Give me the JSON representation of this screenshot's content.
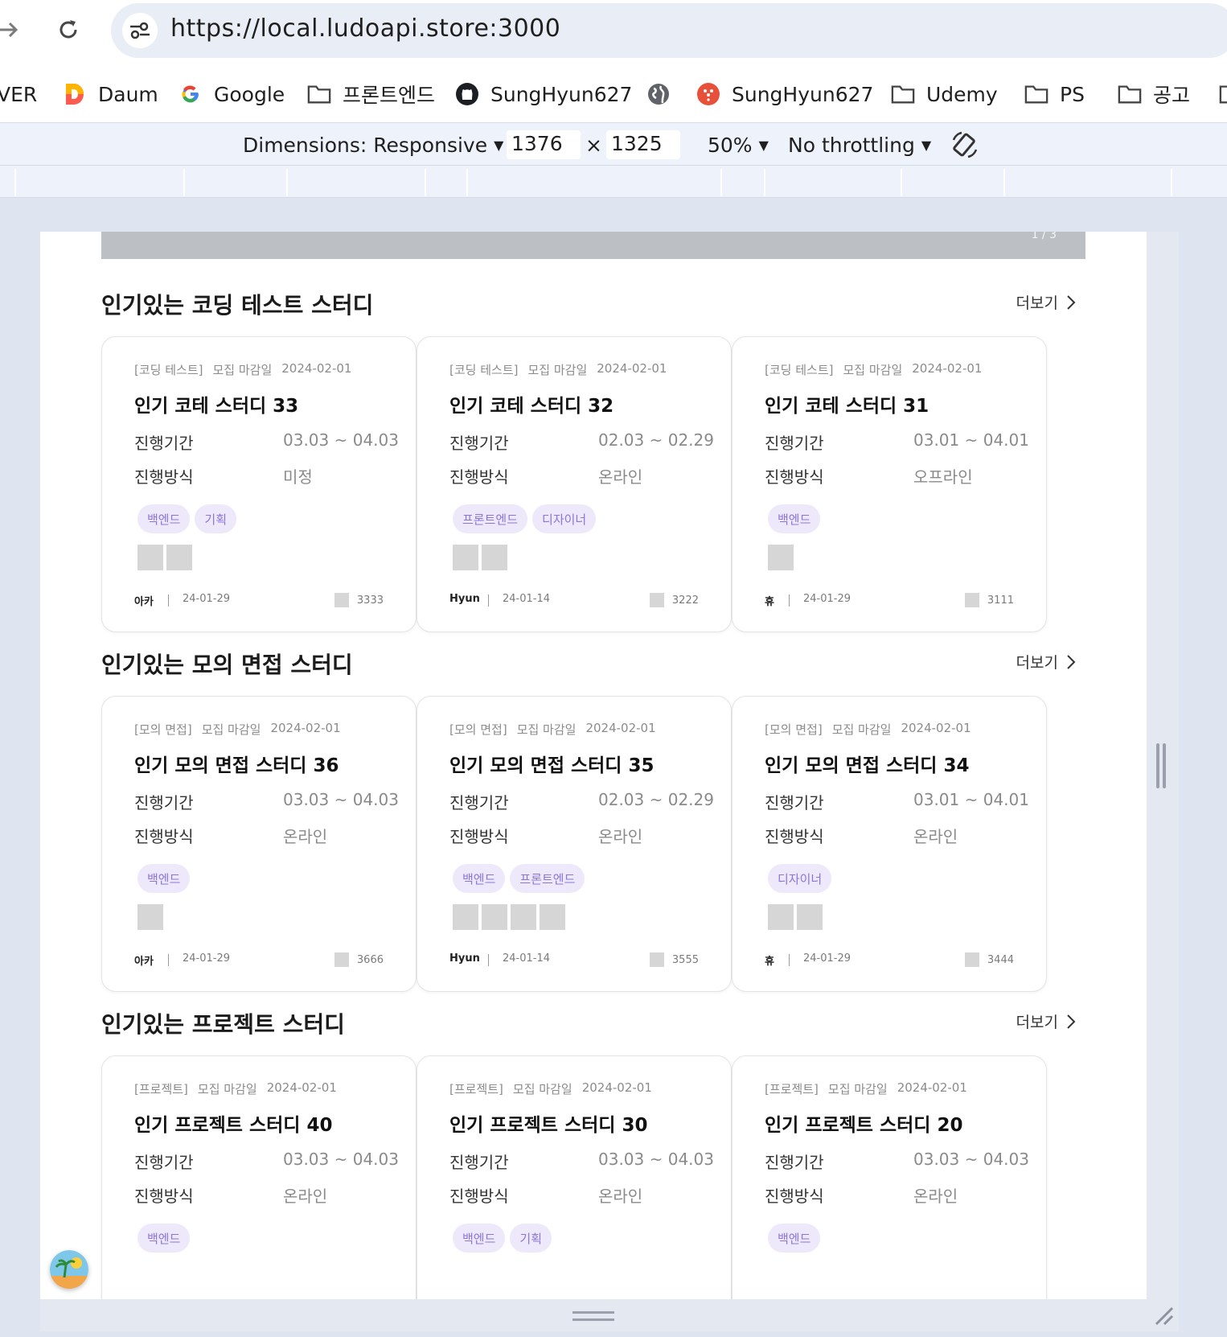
{
  "browser": {
    "url": "https://local.ludoapi.store:3000",
    "bookmarks": [
      {
        "label": "VER",
        "icon": "naver-icon"
      },
      {
        "label": "Daum",
        "icon": "daum-icon"
      },
      {
        "label": "Google",
        "icon": "google-icon"
      },
      {
        "label": "프론트엔드",
        "icon": "folder-icon"
      },
      {
        "label": "SungHyun627",
        "icon": "github-icon"
      },
      {
        "label": "",
        "icon": "globe-icon"
      },
      {
        "label": "SungHyun627",
        "icon": "app-icon"
      },
      {
        "label": "Udemy",
        "icon": "folder-icon"
      },
      {
        "label": "PS",
        "icon": "folder-icon"
      },
      {
        "label": "공고",
        "icon": "folder-icon"
      }
    ]
  },
  "devtools": {
    "dimensions_label": "Dimensions: Responsive",
    "width": "1376",
    "times": "×",
    "height": "1325",
    "zoom": "50%",
    "throttling": "No throttling"
  },
  "banner": {
    "page_indicator": "1 / 3"
  },
  "sections": [
    {
      "title": "인기있는 코딩 테스트 스터디",
      "more_label": "더보기",
      "cards": [
        {
          "category": "[코딩 테스트]",
          "deadline_label": "모집 마감일",
          "deadline": "2024-02-01",
          "title": "인기 코테 스터디 33",
          "period_label": "진행기간",
          "period": "03.03 ~ 04.03",
          "method_label": "진행방식",
          "method": "미정",
          "tags": [
            "백엔드",
            "기획"
          ],
          "stack_count": 2,
          "author": "아카",
          "created": "24-01-29",
          "views": "3333"
        },
        {
          "category": "[코딩 테스트]",
          "deadline_label": "모집 마감일",
          "deadline": "2024-02-01",
          "title": "인기 코테 스터디 32",
          "period_label": "진행기간",
          "period": "02.03 ~ 02.29",
          "method_label": "진행방식",
          "method": "온라인",
          "tags": [
            "프론트엔드",
            "디자이너"
          ],
          "stack_count": 2,
          "author": "Hyun",
          "created": "24-01-14",
          "views": "3222"
        },
        {
          "category": "[코딩 테스트]",
          "deadline_label": "모집 마감일",
          "deadline": "2024-02-01",
          "title": "인기 코테 스터디 31",
          "period_label": "진행기간",
          "period": "03.01 ~ 04.01",
          "method_label": "진행방식",
          "method": "오프라인",
          "tags": [
            "백엔드"
          ],
          "stack_count": 1,
          "author": "휴",
          "created": "24-01-29",
          "views": "3111"
        }
      ]
    },
    {
      "title": "인기있는 모의 면접 스터디",
      "more_label": "더보기",
      "cards": [
        {
          "category": "[모의 면접]",
          "deadline_label": "모집 마감일",
          "deadline": "2024-02-01",
          "title": "인기 모의 면접 스터디 36",
          "period_label": "진행기간",
          "period": "03.03 ~ 04.03",
          "method_label": "진행방식",
          "method": "온라인",
          "tags": [
            "백엔드"
          ],
          "stack_count": 1,
          "author": "아카",
          "created": "24-01-29",
          "views": "3666"
        },
        {
          "category": "[모의 면접]",
          "deadline_label": "모집 마감일",
          "deadline": "2024-02-01",
          "title": "인기 모의 면접 스터디 35",
          "period_label": "진행기간",
          "period": "02.03 ~ 02.29",
          "method_label": "진행방식",
          "method": "온라인",
          "tags": [
            "백엔드",
            "프론트엔드"
          ],
          "stack_count": 4,
          "author": "Hyun",
          "created": "24-01-14",
          "views": "3555"
        },
        {
          "category": "[모의 면접]",
          "deadline_label": "모집 마감일",
          "deadline": "2024-02-01",
          "title": "인기 모의 면접 스터디 34",
          "period_label": "진행기간",
          "period": "03.01 ~ 04.01",
          "method_label": "진행방식",
          "method": "온라인",
          "tags": [
            "디자이너"
          ],
          "stack_count": 2,
          "author": "휴",
          "created": "24-01-29",
          "views": "3444"
        }
      ]
    },
    {
      "title": "인기있는 프로젝트 스터디",
      "more_label": "더보기",
      "cards": [
        {
          "category": "[프로젝트]",
          "deadline_label": "모집 마감일",
          "deadline": "2024-02-01",
          "title": "인기 프로젝트 스터디 40",
          "period_label": "진행기간",
          "period": "03.03 ~ 04.03",
          "method_label": "진행방식",
          "method": "온라인",
          "tags": [
            "백엔드"
          ],
          "stack_count": 0,
          "author": "",
          "created": "",
          "views": ""
        },
        {
          "category": "[프로젝트]",
          "deadline_label": "모집 마감일",
          "deadline": "2024-02-01",
          "title": "인기 프로젝트 스터디 30",
          "period_label": "진행기간",
          "period": "03.03 ~ 04.03",
          "method_label": "진행방식",
          "method": "온라인",
          "tags": [
            "백엔드",
            "기획"
          ],
          "stack_count": 0,
          "author": "",
          "created": "",
          "views": ""
        },
        {
          "category": "[프로젝트]",
          "deadline_label": "모집 마감일",
          "deadline": "2024-02-01",
          "title": "인기 프로젝트 스터디 20",
          "period_label": "진행기간",
          "period": "03.03 ~ 04.03",
          "method_label": "진행방식",
          "method": "온라인",
          "tags": [
            "백엔드"
          ],
          "stack_count": 0,
          "author": "",
          "created": "",
          "views": ""
        }
      ]
    }
  ],
  "colors": {
    "tag_bg": "#ede9fb",
    "tag_text": "#8d75d8",
    "banner": "#bcbfc4"
  }
}
